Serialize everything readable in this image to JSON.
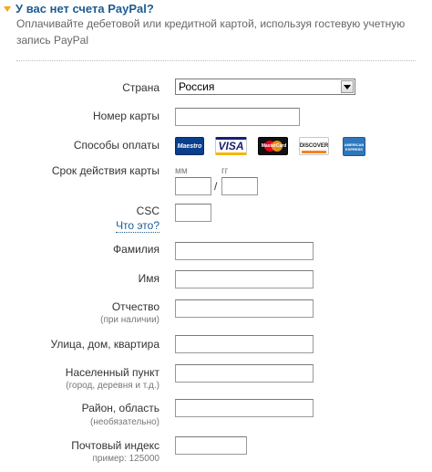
{
  "header": {
    "title": "У вас нет счета PayPal?",
    "subtitle": "Оплачивайте дебетовой или кредитной картой, используя гостевую учетную запись PayPal"
  },
  "form": {
    "country": {
      "label": "Страна",
      "value": "Россия"
    },
    "card_number": {
      "label": "Номер карты",
      "value": ""
    },
    "payment_methods": {
      "label": "Способы оплаты",
      "cards": [
        "Maestro",
        "VISA",
        "MasterCard",
        "DISCOVER",
        "AMERICAN EXPRESS"
      ]
    },
    "expiry": {
      "label": "Срок действия карты",
      "month_hint": "мм",
      "year_hint": "гг",
      "separator": "/"
    },
    "csc": {
      "label": "CSC",
      "help_link": "Что это?"
    },
    "last_name": {
      "label": "Фамилия"
    },
    "first_name": {
      "label": "Имя"
    },
    "middle_name": {
      "label": "Отчество",
      "hint": "(при наличии)"
    },
    "street": {
      "label": "Улица, дом, квартира"
    },
    "city": {
      "label": "Населенный пункт",
      "hint": "(город, деревня и т.д.)"
    },
    "region": {
      "label": "Район, область",
      "hint": "(необязательно)"
    },
    "postal_code": {
      "label": "Почтовый индекс",
      "hint": "пример: 125000"
    }
  },
  "colors": {
    "title": "#1d5c92",
    "link": "#1d5c92",
    "accent_arrow": "#f4a81c",
    "visa_blue": "#1a1f71",
    "mastercard_red": "#eb001b",
    "mastercard_orange": "#f79e1b",
    "discover_orange": "#f58220",
    "amex_blue": "#2e77bc"
  },
  "icons": {
    "header": "triangle-down-icon",
    "select": "chevron-down-icon"
  }
}
